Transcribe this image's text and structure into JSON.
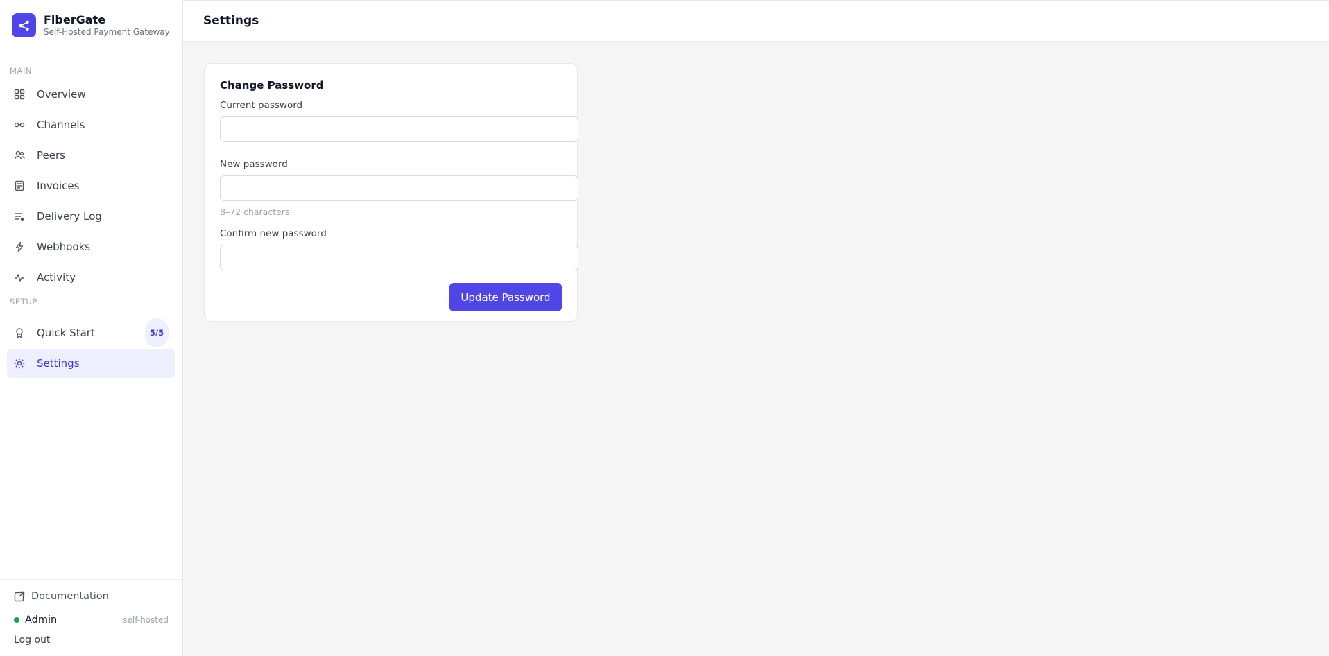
{
  "brand": {
    "name": "FiberGate",
    "tagline": "Self-Hosted Payment Gateway",
    "logo_icon": "share-nodes-icon",
    "accent_color": "#4f46e5"
  },
  "sidebar": {
    "sections": [
      {
        "label": "MAIN"
      },
      {
        "label": "SETUP"
      }
    ],
    "main_items": [
      {
        "label": "Overview",
        "icon": "grid-icon"
      },
      {
        "label": "Channels",
        "icon": "link-icon"
      },
      {
        "label": "Peers",
        "icon": "users-icon"
      },
      {
        "label": "Invoices",
        "icon": "document-icon"
      },
      {
        "label": "Delivery Log",
        "icon": "list-log-icon"
      },
      {
        "label": "Webhooks",
        "icon": "bolt-icon"
      },
      {
        "label": "Activity",
        "icon": "pulse-icon"
      }
    ],
    "setup_items": [
      {
        "label": "Quick Start",
        "icon": "award-icon",
        "badge": "5/5"
      },
      {
        "label": "Settings",
        "icon": "gear-icon",
        "active": true
      }
    ],
    "footer": {
      "documentation": "Documentation",
      "user": "Admin",
      "deployment": "self-hosted",
      "logout": "Log out",
      "status_color": "#16a34a"
    }
  },
  "header": {
    "title": "Settings"
  },
  "password_form": {
    "title": "Change Password",
    "current_label": "Current password",
    "current_value": "",
    "new_label": "New password",
    "new_value": "",
    "new_help": "8–72 characters.",
    "confirm_label": "Confirm new password",
    "confirm_value": "",
    "submit_label": "Update Password"
  }
}
